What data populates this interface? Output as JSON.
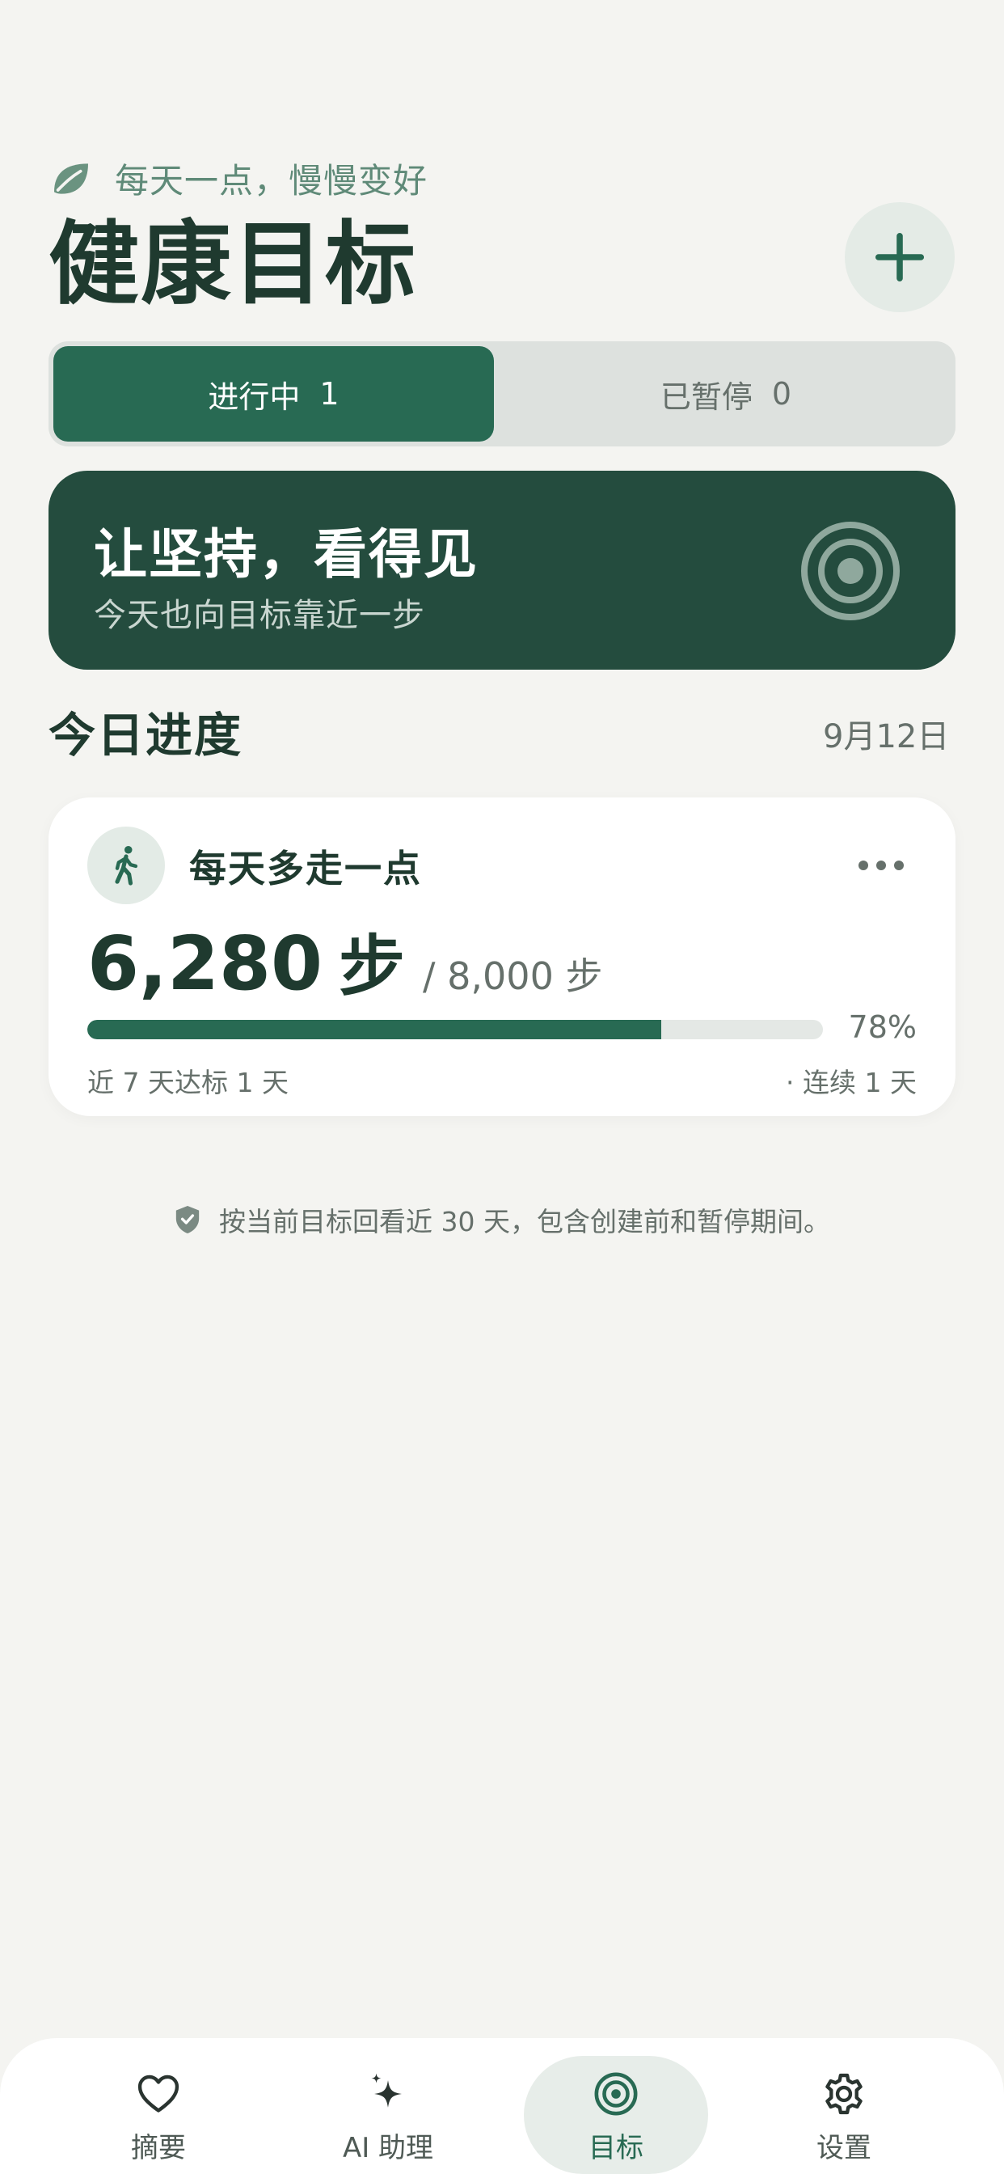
{
  "header": {
    "slogan": "每天一点，慢慢变好",
    "slogan_icon": "leaf-icon",
    "title": "健康目标",
    "add_icon": "plus-icon"
  },
  "segmented": {
    "active": {
      "label": "进行中",
      "count": "1"
    },
    "paused": {
      "label": "已暂停",
      "count": "0"
    }
  },
  "banner": {
    "title": "让坚持，看得见",
    "subtitle": "今天也向目标靠近一步",
    "icon": "target-icon"
  },
  "section": {
    "title": "今日进度",
    "date": "9月12日"
  },
  "goal_card": {
    "icon": "walking-icon",
    "title": "每天多走一点",
    "value": "6,280",
    "value_unit": "步",
    "target": "/ 8,000 步",
    "progress_fraction": 0.78,
    "percent_label": "78%",
    "stat_left": "近 7 天达标 1 天",
    "stat_right": "· 连续 1 天",
    "more_icon": "more-icon"
  },
  "footnote": {
    "icon": "shield-check-icon",
    "text": "按当前目标回看近 30 天，包含创建前和暂停期间。"
  },
  "bottom_nav": {
    "items": [
      {
        "label": "摘要",
        "icon": "heart-icon"
      },
      {
        "label": "AI 助理",
        "icon": "sparkles-icon"
      },
      {
        "label": "目标",
        "icon": "target-icon"
      },
      {
        "label": "设置",
        "icon": "gear-icon"
      }
    ],
    "active_index": 2
  },
  "colors": {
    "background": "#f4f4f1",
    "primary": "#286a53",
    "banner": "#244c3e",
    "text_dark": "#1f3a2f",
    "text_muted": "#66706b",
    "accent_soft": "#e4ebe6"
  }
}
